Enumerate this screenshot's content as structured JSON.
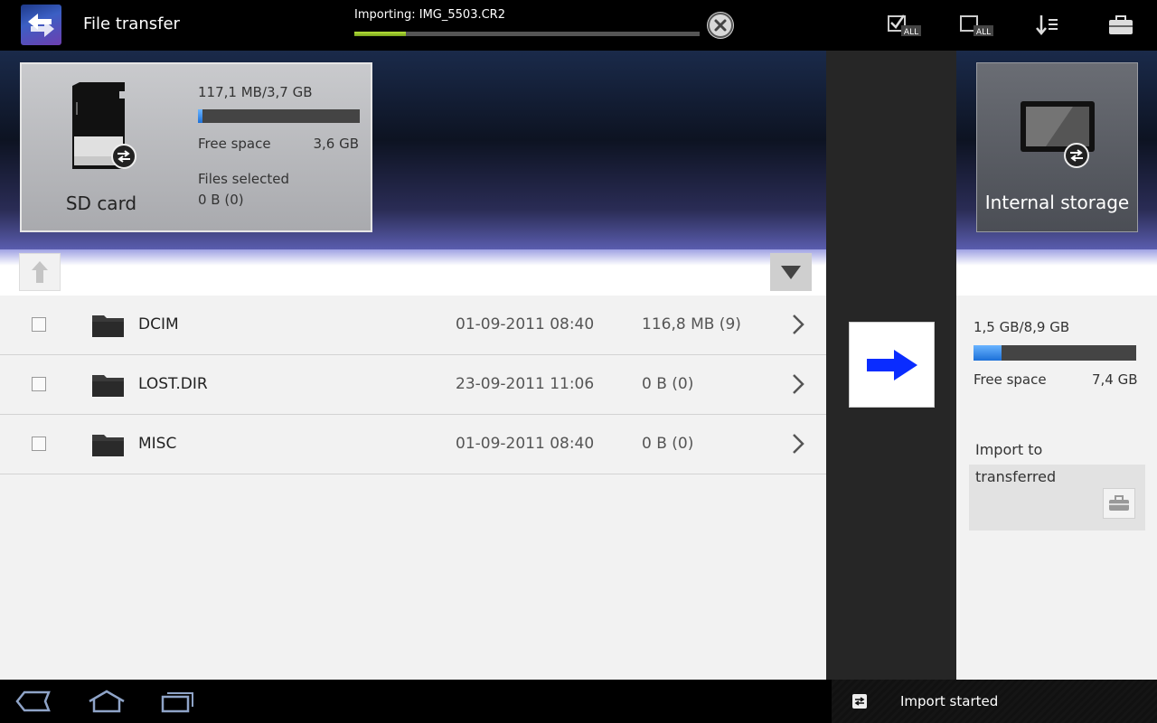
{
  "app": {
    "title": "File transfer"
  },
  "import_status": {
    "label": "Importing: IMG_5503.CR2",
    "progress": 0.15
  },
  "actionbar": {
    "icons": [
      "select-all-icon",
      "deselect-all-icon",
      "sort-order-icon",
      "toolbox-icon"
    ],
    "badge_text": "ALL"
  },
  "source": {
    "name": "SD card",
    "capacity": "117,1 MB/3,7 GB",
    "used_fraction": 0.03,
    "free_label": "Free space",
    "free_value": "3,6 GB",
    "selected_label": "Files selected",
    "selected_value": "0 B (0)"
  },
  "files": [
    {
      "name": "DCIM",
      "date": "01-09-2011 08:40",
      "size": "116,8 MB (9)"
    },
    {
      "name": "LOST.DIR",
      "date": "23-09-2011 11:06",
      "size": "0 B (0)"
    },
    {
      "name": "MISC",
      "date": "01-09-2011 08:40",
      "size": "0 B (0)"
    }
  ],
  "destination": {
    "name": "Internal storage",
    "capacity": "1,5 GB/8,9 GB",
    "used_fraction": 0.17,
    "free_label": "Free space",
    "free_value": "7,4 GB",
    "import_label": "Import to",
    "folder": "transferred"
  },
  "notification": {
    "text": "Import started"
  },
  "colors": {
    "accent_blue": "#1c70d8",
    "progress_green": "#9acd32",
    "arrow_blue": "#0a2cff"
  }
}
